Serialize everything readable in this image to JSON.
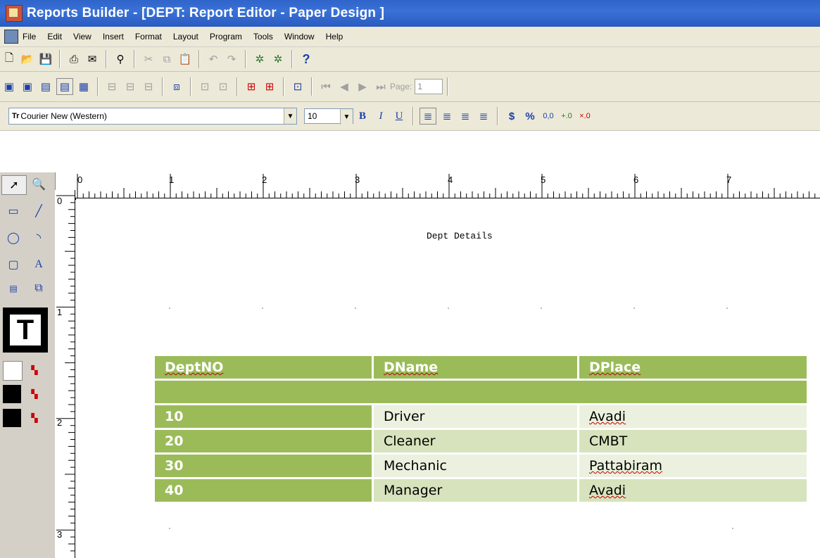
{
  "window": {
    "title": "Reports Builder - [DEPT: Report Editor - Paper Design ]"
  },
  "menu": [
    "File",
    "Edit",
    "View",
    "Insert",
    "Format",
    "Layout",
    "Program",
    "Tools",
    "Window",
    "Help"
  ],
  "toolbar": {
    "page_label": "Page:",
    "page_value": "1",
    "font_name": "Courier New (Western)",
    "font_size": "10",
    "bold": "B",
    "italic": "I",
    "underline": "U",
    "currency": "$",
    "percent": "%",
    "help": "?"
  },
  "ruler": {
    "h_marks": [
      "0",
      "1",
      "2",
      "3",
      "4",
      "5",
      "6",
      "7"
    ],
    "v_marks": [
      "0",
      "1",
      "2",
      "3"
    ]
  },
  "report": {
    "title": "Dept Details",
    "columns": [
      "DeptNO",
      "DName",
      "DPlace"
    ],
    "rows": [
      [
        "10",
        "Driver",
        "Avadi"
      ],
      [
        "20",
        "Cleaner",
        "CMBT"
      ],
      [
        "30",
        "Mechanic",
        "Pattabiram"
      ],
      [
        "40",
        "Manager",
        "Avadi"
      ]
    ]
  },
  "colors": {
    "header_green": "#9bbb59",
    "row_light": "#ebf1de",
    "row_mid": "#d7e3bc",
    "titlebar": "#2f64c9"
  }
}
